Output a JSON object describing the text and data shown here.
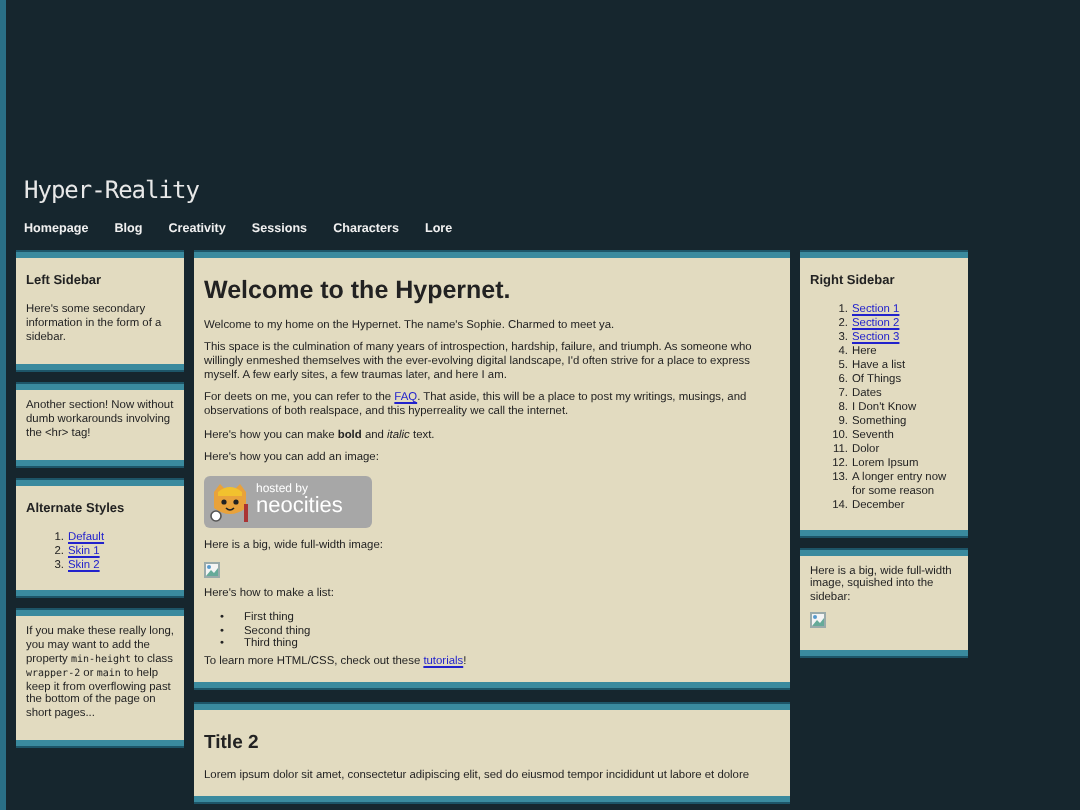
{
  "site_title": "Hyper-Reality",
  "nav": [
    {
      "label": "Homepage"
    },
    {
      "label": "Blog"
    },
    {
      "label": "Creativity"
    },
    {
      "label": "Sessions"
    },
    {
      "label": "Characters"
    },
    {
      "label": "Lore"
    }
  ],
  "left_sidebar": [
    {
      "heading": "Left Sidebar",
      "segments": [
        {
          "kind": "text",
          "text": "Here's some secondary information in the form of a sidebar."
        }
      ]
    },
    {
      "segments": [
        {
          "kind": "text",
          "text": "Another section! Now without dumb workarounds involving the <hr> tag!"
        }
      ]
    },
    {
      "heading": "Alternate Styles",
      "list": [
        {
          "marker": "1.",
          "text": "Default",
          "link": true
        },
        {
          "marker": "2.",
          "text": "Skin 1",
          "link": true
        },
        {
          "marker": "3.",
          "text": "Skin 2",
          "link": true
        }
      ]
    },
    {
      "segments": [
        {
          "kind": "text",
          "text": "If you make these really long, you may want to add the property "
        },
        {
          "kind": "code",
          "text": "min-height"
        },
        {
          "kind": "text",
          "text": " to class "
        },
        {
          "kind": "code",
          "text": "wrapper-2"
        },
        {
          "kind": "text",
          "text": " or "
        },
        {
          "kind": "code",
          "text": "main"
        },
        {
          "kind": "text",
          "text": " to help keep it from overflowing past the bottom of the page on short pages..."
        }
      ]
    }
  ],
  "main": [
    {
      "heading": "Welcome to the Hypernet.",
      "blocks": [
        {
          "kind": "paragraph",
          "segments": [
            {
              "kind": "text",
              "text": "Welcome to my home on the Hypernet. The name's Sophie. Charmed to meet ya."
            }
          ]
        },
        {
          "kind": "paragraph",
          "segments": [
            {
              "kind": "text",
              "text": "This space is the culmination of many years of introspection, hardship, failure, and triumph. As someone who willingly enmeshed themselves with the ever-evolving digital landscape, I'd often strive for a place to express myself. A few early sites, a few traumas later, and here I am."
            }
          ]
        },
        {
          "kind": "paragraph",
          "segments": [
            {
              "kind": "text",
              "text": "For deets on me, you can refer to the "
            },
            {
              "kind": "link",
              "text": "FAQ"
            },
            {
              "kind": "text",
              "text": ". That aside, this will be a place to post my writings, musings, and observations of both realspace, and this hyperreality we call the internet."
            }
          ]
        },
        {
          "kind": "paragraph",
          "segments": [
            {
              "kind": "text",
              "text": "Here's how you can make **bold** and *italic* text."
            }
          ]
        },
        {
          "kind": "paragraph",
          "segments": [
            {
              "kind": "text",
              "text": "Here's how you can add an image:"
            }
          ]
        },
        {
          "kind": "badge",
          "small": "hosted by",
          "big": "neocities"
        },
        {
          "kind": "paragraph",
          "segments": [
            {
              "kind": "text",
              "text": "Here is a big, wide full-width image:"
            }
          ]
        },
        {
          "kind": "broken_image"
        },
        {
          "kind": "paragraph",
          "segments": [
            {
              "kind": "text",
              "text": "Here's how to make a list:"
            }
          ]
        },
        {
          "kind": "list",
          "items": [
            {
              "marker": "•",
              "text": "First thing"
            },
            {
              "marker": "•",
              "text": "Second thing"
            },
            {
              "marker": "•",
              "text": "Third thing"
            }
          ]
        },
        {
          "kind": "paragraph",
          "segments": [
            {
              "kind": "text",
              "text": "To learn more HTML/CSS, check out these "
            },
            {
              "kind": "link",
              "text": "tutorials"
            },
            {
              "kind": "text",
              "text": "!"
            }
          ]
        }
      ]
    },
    {
      "heading": "Title 2",
      "blocks": [
        {
          "kind": "paragraph",
          "segments": [
            {
              "kind": "text",
              "text": "Lorem ipsum dolor sit amet, consectetur adipiscing elit, sed do eiusmod tempor incididunt ut labore et dolore"
            }
          ]
        }
      ]
    }
  ],
  "right_sidebar": [
    {
      "heading": "Right Sidebar",
      "blocks": [
        {
          "kind": "list",
          "items": [
            {
              "marker": "1.",
              "text": "Section 1",
              "link": true
            },
            {
              "marker": "2.",
              "text": "Section 2",
              "link": true
            },
            {
              "marker": "3.",
              "text": "Section 3",
              "link": true
            },
            {
              "marker": "4.",
              "text": "Here",
              "link": false
            },
            {
              "marker": "5.",
              "text": "Have a list",
              "link": false
            },
            {
              "marker": "6.",
              "text": "Of Things",
              "link": false
            },
            {
              "marker": "7.",
              "text": "Dates",
              "link": false
            },
            {
              "marker": "8.",
              "text": "I Don't Know",
              "link": false
            },
            {
              "marker": "9.",
              "text": "Something",
              "link": false
            },
            {
              "marker": "10.",
              "text": "Seventh",
              "link": false
            },
            {
              "marker": "11.",
              "text": "Dolor",
              "link": false
            },
            {
              "marker": "12.",
              "text": "Lorem Ipsum",
              "link": false
            },
            {
              "marker": "13.",
              "text": "A longer entry now for some reason",
              "link": false
            },
            {
              "marker": "14.",
              "text": "December",
              "link": false
            }
          ]
        }
      ]
    },
    {
      "blocks": [
        {
          "kind": "paragraph",
          "segments": [
            {
              "kind": "text",
              "text": "Here is a big, wide full-width image, squished into the sidebar:"
            }
          ]
        },
        {
          "kind": "broken_image"
        }
      ]
    }
  ]
}
